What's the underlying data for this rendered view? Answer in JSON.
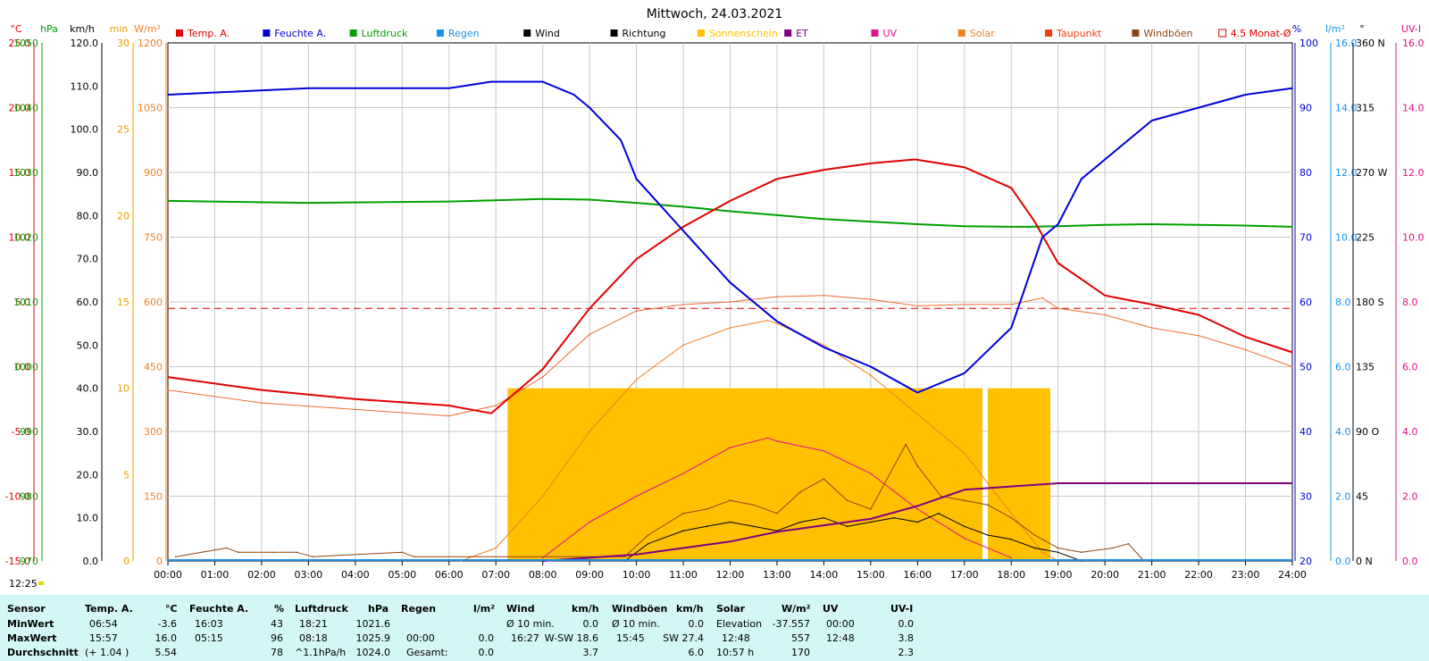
{
  "chart_data": {
    "type": "line",
    "title": "Mittwoch, 24.03.2021",
    "time_readout": "12:25",
    "x_ticks": [
      "00:00",
      "01:00",
      "02:00",
      "03:00",
      "04:00",
      "05:00",
      "06:00",
      "07:00",
      "08:00",
      "09:00",
      "10:00",
      "11:00",
      "12:00",
      "13:00",
      "14:00",
      "15:00",
      "16:00",
      "17:00",
      "18:00",
      "19:00",
      "20:00",
      "21:00",
      "22:00",
      "23:00",
      "24:00"
    ],
    "legend": [
      {
        "label": "Temp. A.",
        "color": "#e00000",
        "box": "filled"
      },
      {
        "label": "Feuchte A.",
        "color": "#0000dd",
        "box": "filled"
      },
      {
        "label": "Luftdruck",
        "color": "#00a000",
        "box": "filled"
      },
      {
        "label": "Regen",
        "color": "#1890e8",
        "box": "filled"
      },
      {
        "label": "Wind",
        "color": "#000000",
        "box": "filled"
      },
      {
        "label": "Richtung",
        "color": "#000000",
        "box": "filled"
      },
      {
        "label": "Sonnenschein",
        "color": "#ffc000",
        "box": "filled"
      },
      {
        "label": "ET",
        "color": "#800080",
        "box": "filled"
      },
      {
        "label": "UV",
        "color": "#e0108c",
        "box": "filled"
      },
      {
        "label": "Solar",
        "color": "#f08020",
        "box": "filled"
      },
      {
        "label": "Taupunkt",
        "color": "#f04010",
        "box": "filled"
      },
      {
        "label": "Windböen",
        "color": "#8b4513",
        "box": "filled"
      },
      {
        "label": "4.5 Monat-Ø",
        "color": "#e00000",
        "box": "outline"
      }
    ],
    "axes_left": [
      {
        "unit": "°C",
        "color": "#e00000",
        "ticks": [
          "25.0",
          "20.0",
          "15.0",
          "10.0",
          "5.0",
          "0.0",
          "-5.0",
          "-10.0",
          "-15.0"
        ]
      },
      {
        "unit": "hPa",
        "color": "#00a000",
        "ticks": [
          "1050",
          "1040",
          "1030",
          "1020",
          "1010",
          "1000",
          "990",
          "980",
          "970"
        ]
      },
      {
        "unit": "km/h",
        "color": "#000000",
        "ticks": [
          "120.0",
          "110.0",
          "100.0",
          "90.0",
          "80.0",
          "70.0",
          "60.0",
          "50.0",
          "40.0",
          "30.0",
          "20.0",
          "10.0",
          "0.0"
        ]
      },
      {
        "unit": "min",
        "color": "#e8a000",
        "ticks": [
          "30",
          "25",
          "20",
          "15",
          "10",
          "5",
          "0"
        ]
      },
      {
        "unit": "W/m²",
        "color": "#f08020",
        "ticks": [
          "1200",
          "1050",
          "900",
          "750",
          "600",
          "450",
          "300",
          "150",
          "0"
        ]
      }
    ],
    "axes_right": [
      {
        "unit": "%",
        "color": "#0000dd",
        "ticks": [
          "100",
          "90",
          "80",
          "70",
          "60",
          "50",
          "40",
          "30",
          "20"
        ]
      },
      {
        "unit": "l/m²",
        "color": "#1890e8",
        "ticks": [
          "16.0",
          "14.0",
          "12.0",
          "10.0",
          "8.0",
          "6.0",
          "4.0",
          "2.0",
          "0.0"
        ]
      },
      {
        "unit": "°",
        "color": "#000000",
        "ticks": [
          "360 N",
          "315",
          "270 W",
          "225",
          "180 S",
          "135",
          "90 O",
          "45",
          "0 N"
        ]
      },
      {
        "unit": "UV-I",
        "color": "#e0108c",
        "ticks": [
          "16.0",
          "14.0",
          "12.0",
          "10.0",
          "8.0",
          "6.0",
          "4.0",
          "2.0",
          "0.0"
        ]
      }
    ],
    "monthly_avg_temp": 4.5,
    "series": [
      {
        "name": "Temp. A.",
        "unit": "°C",
        "x": [
          "00:00",
          "02:00",
          "04:00",
          "06:00",
          "06:54",
          "08:00",
          "09:00",
          "10:00",
          "11:00",
          "12:00",
          "13:00",
          "14:00",
          "15:00",
          "15:57",
          "17:00",
          "18:00",
          "18:30",
          "19:00",
          "20:00",
          "21:00",
          "22:00",
          "23:00",
          "24:00"
        ],
        "y": [
          -0.8,
          -1.8,
          -2.5,
          -3.0,
          -3.6,
          -0.2,
          4.5,
          8.3,
          10.8,
          12.8,
          14.5,
          15.2,
          15.7,
          16.0,
          15.4,
          13.8,
          11.2,
          8.0,
          5.5,
          4.8,
          4.0,
          2.3,
          1.1
        ]
      },
      {
        "name": "Taupunkt",
        "unit": "°C",
        "x": [
          "00:00",
          "02:00",
          "04:00",
          "06:00",
          "07:00",
          "08:00",
          "09:00",
          "10:00",
          "11:00",
          "12:00",
          "13:00",
          "14:00",
          "15:00",
          "16:00",
          "17:00",
          "18:00",
          "18:40",
          "19:00",
          "20:00",
          "21:00",
          "22:00",
          "23:00",
          "24:00"
        ],
        "y": [
          -1.8,
          -2.8,
          -3.3,
          -3.8,
          -3.0,
          -0.8,
          2.5,
          4.3,
          4.8,
          5.0,
          5.4,
          5.5,
          5.2,
          4.7,
          4.8,
          4.8,
          5.3,
          4.5,
          4.0,
          3.0,
          2.4,
          1.3,
          0.0
        ]
      },
      {
        "name": "Feuchte A.",
        "unit": "%",
        "x": [
          "00:00",
          "03:00",
          "06:00",
          "06:54",
          "08:00",
          "08:40",
          "09:00",
          "09:40",
          "10:00",
          "11:00",
          "12:00",
          "13:00",
          "14:00",
          "15:00",
          "16:00",
          "17:00",
          "18:00",
          "18:40",
          "19:00",
          "19:30",
          "20:00",
          "21:00",
          "22:00",
          "23:00",
          "24:00"
        ],
        "y": [
          92,
          93,
          93,
          94,
          94,
          92,
          90,
          85,
          79,
          71,
          63,
          57,
          53,
          50,
          46,
          49,
          56,
          70,
          72,
          79,
          82,
          88,
          90,
          92,
          93
        ]
      },
      {
        "name": "Luftdruck",
        "unit": "hPa",
        "x": [
          "00:00",
          "03:00",
          "06:00",
          "08:00",
          "09:00",
          "10:00",
          "11:00",
          "12:00",
          "13:00",
          "14:00",
          "15:00",
          "16:00",
          "17:00",
          "18:00",
          "18:21",
          "19:00",
          "20:00",
          "21:00",
          "22:00",
          "23:00",
          "24:00"
        ],
        "y": [
          1025.6,
          1025.3,
          1025.5,
          1025.9,
          1025.8,
          1025.3,
          1024.7,
          1024.0,
          1023.4,
          1022.8,
          1022.4,
          1022.0,
          1021.7,
          1021.6,
          1021.6,
          1021.7,
          1021.9,
          1022.0,
          1021.9,
          1021.8,
          1021.6
        ]
      },
      {
        "name": "Solar",
        "unit": "W/m²",
        "x": [
          "06:15",
          "07:00",
          "08:00",
          "09:00",
          "10:00",
          "11:00",
          "12:00",
          "12:48",
          "13:00",
          "14:00",
          "15:00",
          "16:00",
          "17:00",
          "18:00",
          "18:40",
          "19:00"
        ],
        "y": [
          0,
          30,
          150,
          300,
          420,
          500,
          540,
          557,
          550,
          500,
          430,
          340,
          250,
          110,
          20,
          0
        ]
      },
      {
        "name": "UV",
        "unit": "UV-I",
        "x": [
          "08:00",
          "09:00",
          "10:00",
          "11:00",
          "12:00",
          "12:48",
          "13:00",
          "14:00",
          "15:00",
          "16:00",
          "17:00",
          "18:00"
        ],
        "y": [
          0.1,
          1.2,
          2.0,
          2.7,
          3.5,
          3.8,
          3.7,
          3.4,
          2.7,
          1.6,
          0.7,
          0.1
        ]
      },
      {
        "name": "ET",
        "unit": "l/m²",
        "x": [
          "08:00",
          "10:00",
          "11:00",
          "12:00",
          "13:00",
          "14:00",
          "15:00",
          "16:00",
          "17:00",
          "18:00",
          "19:00",
          "20:00",
          "21:00",
          "22:00",
          "23:00",
          "24:00"
        ],
        "y": [
          0,
          0.2,
          0.4,
          0.6,
          0.9,
          1.1,
          1.3,
          1.7,
          2.2,
          2.3,
          2.4,
          2.4,
          2.4,
          2.4,
          2.4,
          2.4
        ]
      },
      {
        "name": "Wind",
        "unit": "km/h",
        "x": [
          "09:45",
          "10:15",
          "11:00",
          "11:30",
          "12:00",
          "12:30",
          "13:00",
          "13:30",
          "14:00",
          "14:30",
          "15:00",
          "15:30",
          "16:00",
          "16:27",
          "17:00",
          "17:30",
          "18:00",
          "18:30",
          "19:00",
          "19:30"
        ],
        "y": [
          0,
          4,
          7,
          8,
          9,
          8,
          7,
          9,
          10,
          8,
          9,
          10,
          9,
          11,
          8,
          6,
          5,
          3,
          2,
          0
        ]
      },
      {
        "name": "Windböen",
        "unit": "km/h",
        "x": [
          "00:10",
          "01:15",
          "01:30",
          "02:15",
          "02:45",
          "03:05",
          "05:00",
          "05:15",
          "09:45",
          "10:15",
          "11:00",
          "11:30",
          "12:00",
          "12:30",
          "13:00",
          "13:30",
          "14:00",
          "14:30",
          "15:00",
          "15:45",
          "16:00",
          "16:30",
          "17:00",
          "17:30",
          "18:00",
          "18:30",
          "19:00",
          "19:30",
          "20:10",
          "20:30",
          "20:50"
        ],
        "y": [
          1,
          3,
          2,
          2,
          2,
          1,
          2,
          1,
          1,
          6,
          11,
          12,
          14,
          13,
          11,
          16,
          19,
          14,
          12,
          27,
          22,
          15,
          14,
          13,
          10,
          6,
          3,
          2,
          3,
          4,
          0
        ]
      },
      {
        "name": "Sonnenschein",
        "unit": "min",
        "x": [
          "07:15",
          "17:30",
          "18:00",
          "18:50"
        ],
        "y": [
          10,
          10,
          10,
          0
        ]
      }
    ]
  },
  "summary": {
    "headers": {
      "sensor": "Sensor",
      "temp": "Temp. A.",
      "temp_unit": "°C",
      "hum": "Feuchte A.",
      "hum_unit": "%",
      "press": "Luftdruck",
      "press_unit": "hPa",
      "rain": "Regen",
      "rain_unit": "l/m²",
      "wind": "Wind",
      "wind_unit": "km/h",
      "gust": "Windböen",
      "gust_unit": "km/h",
      "solar": "Solar",
      "solar_unit": "W/m²",
      "uv": "UV",
      "uv_unit": "UV-I"
    },
    "row_labels": {
      "min": "MinWert",
      "max": "MaxWert",
      "avg": "Durchschnitt"
    },
    "min": {
      "temp_time": "06:54",
      "temp_val": "-3.6",
      "hum_time": "16:03",
      "hum_val": "43",
      "press_time": "18:21",
      "press_val": "1021.6",
      "rain_time": "",
      "rain_val": "",
      "wind_label": "Ø 10 min.",
      "wind_val": "0.0",
      "gust_label": "Ø 10 min.",
      "gust_val": "0.0",
      "solar_label": "Elevation",
      "solar_val": "-37.557",
      "uv_time": "00:00",
      "uv_val": "0.0"
    },
    "max": {
      "temp_time": "15:57",
      "temp_val": "16.0",
      "hum_time": "05:15",
      "hum_val": "96",
      "press_time": "08:18",
      "press_val": "1025.9",
      "rain_time": "00:00",
      "rain_val": "0.0",
      "wind_time": "16:27",
      "wind_dir": "W-SW 18.6",
      "gust_time": "15:45",
      "gust_dir": "SW 27.4",
      "solar_time": "12:48",
      "solar_val": "557",
      "uv_time": "12:48",
      "uv_val": "3.8"
    },
    "avg": {
      "temp_delta": "(+ 1.04 )",
      "temp_val": "5.54",
      "hum_val": "78",
      "press_trend": "^1.1hPa/h",
      "press_val": "1024.0",
      "rain_label": "Gesamt:",
      "rain_val": "0.0",
      "wind_val": "3.7",
      "gust_val": "6.0",
      "solar_label": "10:57 h",
      "solar_val": "170",
      "uv_val": "2.3"
    }
  }
}
